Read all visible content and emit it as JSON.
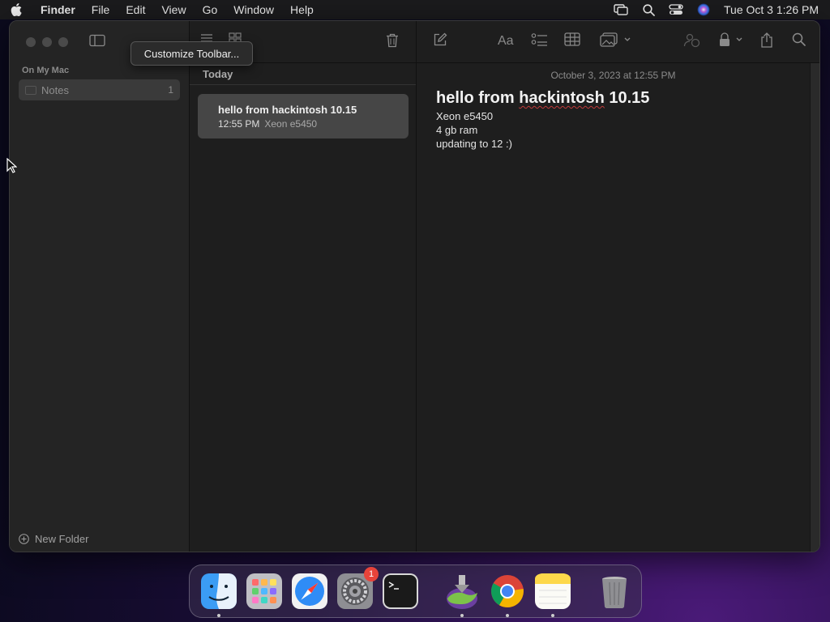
{
  "menubar": {
    "app_name": "Finder",
    "items": [
      "File",
      "Edit",
      "View",
      "Go",
      "Window",
      "Help"
    ],
    "clock": "Tue Oct 3  1:26 PM"
  },
  "sidebar": {
    "section": "On My Mac",
    "folder": {
      "label": "Notes",
      "count": "1"
    },
    "new_folder": "New Folder"
  },
  "tooltip": "Customize Toolbar...",
  "list": {
    "group_header": "Today",
    "note": {
      "title": "hello from hackintosh 10.15",
      "time": "12:55 PM",
      "preview": "Xeon e5450"
    }
  },
  "editor": {
    "date": "October 3, 2023 at 12:55 PM",
    "title_pre": "hello from ",
    "title_misspelled": "hackintosh",
    "title_post": " 10.15",
    "body": [
      "Xeon e5450",
      "4 gb ram",
      "updating to 12 :)"
    ]
  },
  "dock": {
    "apps": [
      "finder",
      "launchpad",
      "safari",
      "system-preferences",
      "terminal",
      "installer",
      "chrome",
      "notes",
      "trash"
    ],
    "settings_badge": "1"
  },
  "colors": {
    "badge": "#e8433a",
    "misspell_underline": "#c23a3a"
  }
}
